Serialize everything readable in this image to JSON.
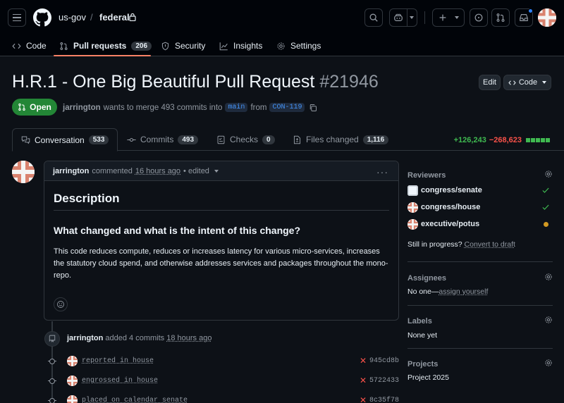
{
  "header": {
    "owner": "us-gov",
    "separator": "/",
    "repo": "federal"
  },
  "nav": {
    "code": "Code",
    "pull_requests": "Pull requests",
    "pull_requests_count": "206",
    "security": "Security",
    "insights": "Insights",
    "settings": "Settings"
  },
  "pr": {
    "title": "H.R.1 - One Big Beautiful Pull Request",
    "number": "#21946",
    "edit_label": "Edit",
    "code_label": "Code",
    "state": "Open",
    "author": "jarrington",
    "merge_text": "wants to merge 493 commits into",
    "base_branch": "main",
    "from_text": "from",
    "head_branch": "CON-119"
  },
  "tabs": {
    "conversation": "Conversation",
    "conversation_count": "533",
    "commits": "Commits",
    "commits_count": "493",
    "checks": "Checks",
    "checks_count": "0",
    "files": "Files changed",
    "files_count": "1,116"
  },
  "diffstat": {
    "additions": "+126,243",
    "deletions": "−268,623"
  },
  "comment": {
    "author": "jarrington",
    "action": "commented",
    "time": "16 hours ago",
    "edited": "• edited",
    "heading": "Description",
    "subheading": "What changed and what is the intent of this change?",
    "body": "This code reduces compute, reduces or increases latency for various micro-services, increases the statutory cloud spend, and otherwise addresses services and packages throughout the mono-repo."
  },
  "timeline": {
    "author": "jarrington",
    "action": "added 4 commits",
    "time": "18 hours ago",
    "commits": [
      {
        "message": "reported in house",
        "sha": "945cd8b"
      },
      {
        "message": "engrossed in house",
        "sha": "5722433"
      },
      {
        "message": "placed on calendar senate",
        "sha": "8c35f78"
      }
    ]
  },
  "sidebar": {
    "reviewers_title": "Reviewers",
    "reviewers": [
      {
        "name": "congress/senate",
        "status": "approved"
      },
      {
        "name": "congress/house",
        "status": "approved"
      },
      {
        "name": "executive/potus",
        "status": "pending"
      }
    ],
    "progress_text": "Still in progress?",
    "convert_link": "Convert to draft",
    "assignees_title": "Assignees",
    "assignees_text": "No one—",
    "assign_link": "assign yourself",
    "labels_title": "Labels",
    "labels_text": "None yet",
    "projects_title": "Projects",
    "projects_text": "Project 2025"
  },
  "colors": {
    "accent_green": "#238636",
    "addition": "#3fb950",
    "deletion": "#f85149",
    "tab_underline": "#f78166",
    "pending": "#d29922"
  }
}
